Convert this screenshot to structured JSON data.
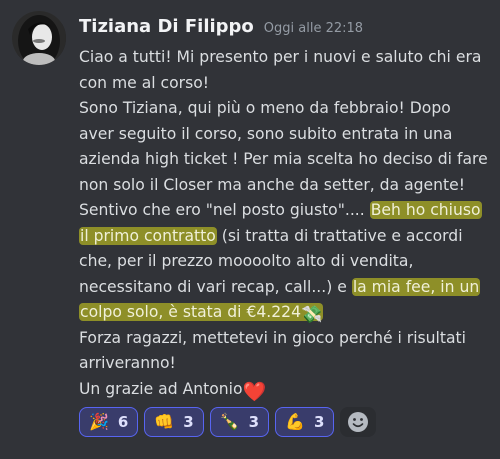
{
  "message": {
    "author": "Tiziana Di Filippo",
    "timestamp": "Oggi alle 22:18",
    "paragraphs": [
      {
        "id": "p1",
        "text": "Ciao a tutti! Mi presento per i nuovi e saluto chi era con me al corso!"
      },
      {
        "id": "p2a",
        "text": "Sono Tiziana, qui più o meno da febbraio! Dopo aver seguito il corso, sono subito entrata in una azienda high ticket ! Per mia scelta ho deciso di fare non solo il Closer ma anche da setter, da agente! Sentivo che ero \"nel posto giusto\".... "
      },
      {
        "id": "p2b_hl",
        "text": "Beh ho chiuso il primo contratto"
      },
      {
        "id": "p2c",
        "text": " (si tratta di trattative e accordi che, per il prezzo moooolto alto di vendita, necessitano di vari recap, call...) e "
      },
      {
        "id": "p2d_hl",
        "text": "la mia fee, in un colpo solo, è stata di €4.224"
      },
      {
        "id": "p3",
        "text": "Forza ragazzi, mettetevi in gioco perché i risultati arriveranno!"
      },
      {
        "id": "p4",
        "text": "Un grazie ad Antonio"
      }
    ],
    "emojis": {
      "money_emoji": "💸",
      "heart_emoji": "❤️"
    }
  },
  "reactions": [
    {
      "emoji": "🎉",
      "icon": "party-popper-icon",
      "count": "6"
    },
    {
      "emoji": "👊",
      "icon": "fist-icon",
      "count": "3"
    },
    {
      "emoji": "🍾",
      "icon": "champagne-icon",
      "count": "3"
    },
    {
      "emoji": "💪",
      "icon": "flexed-biceps-icon",
      "count": "3"
    }
  ],
  "add_reaction_icon": "add-reaction-smiley-icon",
  "colors": {
    "background": "#313338",
    "highlight": "#c8c81e",
    "reaction_border": "#5865f2",
    "heart": "#e0245e"
  }
}
